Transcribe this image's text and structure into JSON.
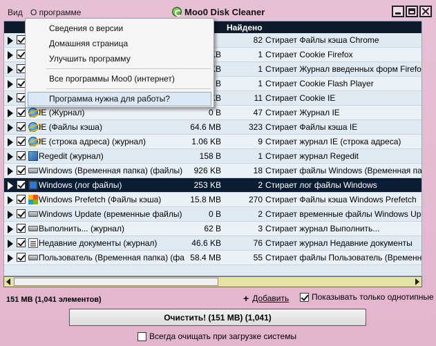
{
  "menu": {
    "view": "Вид",
    "about": "О программе"
  },
  "window": {
    "title": "Moo0 Disk Cleaner"
  },
  "table": {
    "headers": {
      "found": "Найдено"
    },
    "rows": [
      {
        "name": "",
        "size": "",
        "found": "82",
        "desc": "Стирает Файлы кэша Chrome"
      },
      {
        "name": "",
        "size": "KB",
        "found": "1",
        "desc": "Стирает Cookie Firefox"
      },
      {
        "name": "",
        "size": "KB",
        "found": "1",
        "desc": "Стирает Журнал введенных форм Firefox"
      },
      {
        "name": "",
        "size": "B",
        "found": "1",
        "desc": "Стирает Cookie Flash Player"
      },
      {
        "name": "",
        "size": "KB",
        "found": "11",
        "desc": "Стирает Cookie IE"
      },
      {
        "name": "IE (Журнал)",
        "size": "0 B",
        "found": "47",
        "desc": "Стирает Журнал IE"
      },
      {
        "name": "IE (Файлы кэша)",
        "size": "64.6 MB",
        "found": "323",
        "desc": "Стирает Файлы кэша IE"
      },
      {
        "name": "IE (строка адреса) (журнал)",
        "size": "1.06 KB",
        "found": "9",
        "desc": "Стирает журнал IE (строка адреса)"
      },
      {
        "name": "Regedit (журнал)",
        "size": "158 B",
        "found": "1",
        "desc": "Стирает журнал Regedit"
      },
      {
        "name": "Windows (Временная папка) (файлы)",
        "size": "926 KB",
        "found": "18",
        "desc": "Стирает файлы Windows (Временная папка)"
      },
      {
        "name": "Windows (лог файлы)",
        "size": "253 KB",
        "found": "2",
        "desc": "Стирает лог файлы Windows"
      },
      {
        "name": "Windows Prefetch (Файлы кэша)",
        "size": "15.8 MB",
        "found": "270",
        "desc": "Стирает Файлы кэша Windows Prefetch"
      },
      {
        "name": "Windows Update (временные файлы)",
        "size": "0 B",
        "found": "2",
        "desc": "Стирает временные файлы Windows Update"
      },
      {
        "name": "Выполнить... (журнал)",
        "size": "62 B",
        "found": "3",
        "desc": "Стирает журнал Выполнить..."
      },
      {
        "name": "Недавние документы (журнал)",
        "size": "46.6 KB",
        "found": "76",
        "desc": "Стирает журнал Недавние документы"
      },
      {
        "name": "Пользователь (Временная папка) (фа",
        "size": "58.4 MB",
        "found": "55",
        "desc": "Стирает файлы Пользователь (Временная папка)"
      }
    ]
  },
  "dropdown": {
    "items": [
      "Сведения о версии",
      "Домашняя страница",
      "Улучшить программу",
      "Все программы Moo0 (интернет)",
      "Программа нужна для работы?"
    ]
  },
  "footer": {
    "summary": "151 MB  (1,041  элементов)",
    "add_label": "Добавить",
    "only_label": "Показывать только однотипные",
    "clean_label": "Очистить!  (151 MB)  (1,041)",
    "auto_label": "Всегда очищать при загрузке системы"
  },
  "colors": {
    "accent": "#0b1e33",
    "background": "#e5b9d2"
  }
}
